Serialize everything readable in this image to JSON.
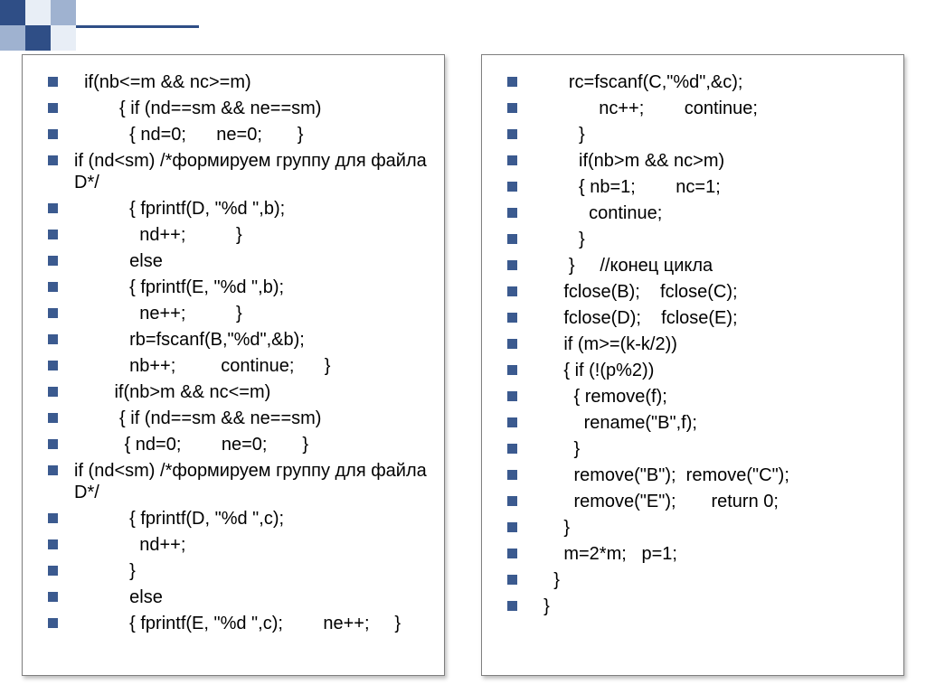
{
  "decor": {
    "colors": {
      "dark": "#2f4e86",
      "mid": "#9fb2d0",
      "light": "#e8eef6"
    }
  },
  "left": {
    "lines": [
      "  if(nb<=m && nc>=m)",
      "         { if (nd==sm && ne==sm)",
      "           { nd=0;      ne=0;       }",
      "           if (nd<sm)                   /*формируем группу для файла D*/",
      "           { fprintf(D, \"%d \",b);",
      "             nd++;          }",
      "           else",
      "           { fprintf(E, \"%d \",b);",
      "             ne++;          }",
      "           rb=fscanf(B,\"%d\",&b);",
      "           nb++;         continue;      }",
      "        if(nb>m && nc<=m)",
      "         { if (nd==sm && ne==sm)",
      "          { nd=0;        ne=0;       }",
      "           if (nd<sm)                  /*формируем группу для файла D*/",
      "           { fprintf(D, \"%d \",c);",
      "             nd++;",
      "           }",
      "           else",
      "           { fprintf(E, \"%d \",c);        ne++;     }"
    ]
  },
  "right": {
    "lines": [
      "       rc=fscanf(C,\"%d\",&c);",
      "             nc++;        continue;",
      "         }",
      "         if(nb>m && nc>m)",
      "         { nb=1;        nc=1;",
      "           continue;",
      "         }",
      "       }     //конец цикла",
      "      fclose(B);    fclose(C);",
      "      fclose(D);    fclose(E);",
      "      if (m>=(k-k/2))",
      "      { if (!(p%2))",
      "        { remove(f);",
      "          rename(\"B\",f);",
      "        }",
      "        remove(\"B\");  remove(\"C\");",
      "        remove(\"E\");       return 0;",
      "      }",
      "      m=2*m;   p=1;",
      "    }",
      "  }"
    ]
  }
}
